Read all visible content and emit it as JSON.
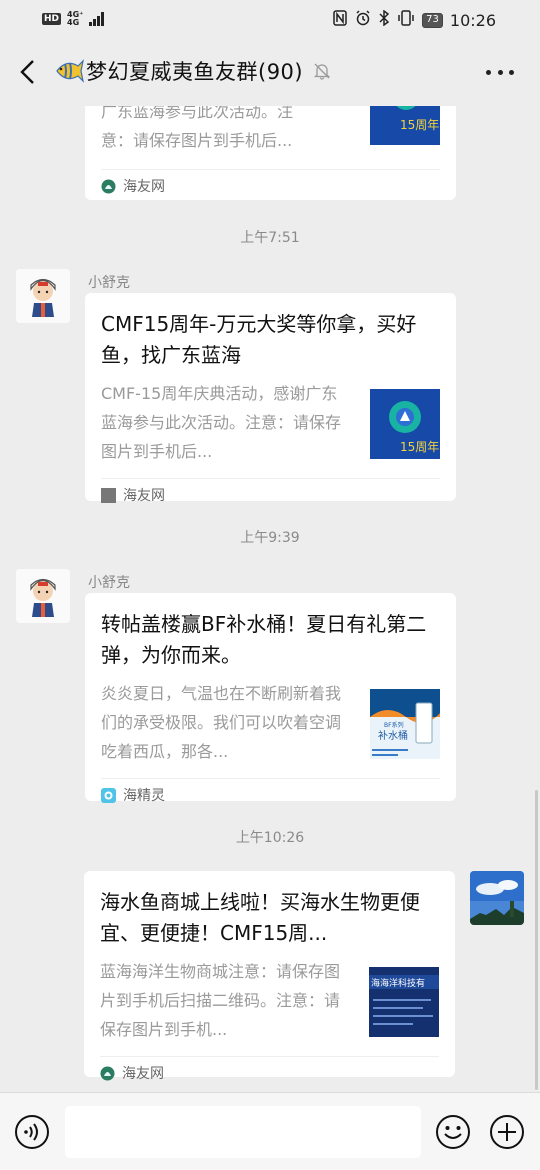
{
  "status_bar": {
    "hd": "HD",
    "network": "4G⁺",
    "network_sub": "4G",
    "battery": "73",
    "time": "10:26"
  },
  "header": {
    "title": "梦幻夏威夷鱼友群(90)"
  },
  "messages": [
    {
      "desc_partial_1": "广东蓝海参与此次活动。注",
      "desc_partial_2": "意：请保存图片到手机后...",
      "source": "海友网"
    },
    {
      "timestamp": "上午7:51",
      "sender": "小舒克",
      "title": "CMF15周年-万元大奖等你拿，买好鱼，找广东蓝海",
      "desc": "CMF-15周年庆典活动，感谢广东蓝海参与此次活动。注意：请保存图片到手机后...",
      "source": "海友网"
    },
    {
      "timestamp": "上午9:39",
      "sender": "小舒克",
      "title": "转帖盖楼赢BF补水桶！夏日有礼第二弹，为你而来。",
      "desc": "炎炎夏日，气温也在不断刷新着我们的承受极限。我们可以吹着空调吃着西瓜，那各...",
      "source": "海精灵"
    },
    {
      "timestamp": "上午10:26",
      "title": "海水鱼商城上线啦！买海水生物更便宜、更便捷！CMF15周...",
      "desc": "蓝海海洋生物商城注意：请保存图片到手机后扫描二维码。注意：请保存图片到手机...",
      "source": "海友网"
    }
  ],
  "thumbs": {
    "anniv_text": "15周年",
    "bf_series": "BF系列",
    "bf_name": "补水桶",
    "mall_banner": "海海洋科技有"
  },
  "input": {
    "placeholder": ""
  }
}
